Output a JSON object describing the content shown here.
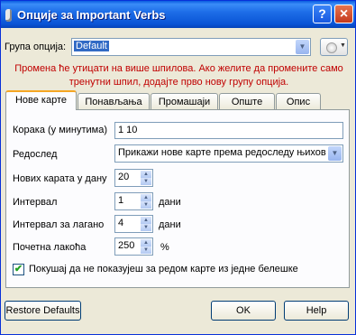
{
  "window": {
    "title": "Опције за Important Verbs",
    "help_button": "?",
    "close_button": "×"
  },
  "option_group": {
    "label": "Група опција:",
    "selected": "Default",
    "options_button_icon": "gear-icon"
  },
  "warning": {
    "line1": "Промена ће утицати на више шпилова. Ако желите да промените само",
    "line2": "тренутни шпил, додајте прво нову групу опција."
  },
  "tabs": [
    {
      "label": "Нове карте",
      "active": true
    },
    {
      "label": "Понављања",
      "active": false
    },
    {
      "label": "Промашаји",
      "active": false
    },
    {
      "label": "Опште",
      "active": false
    },
    {
      "label": "Опис",
      "active": false
    }
  ],
  "new_cards": {
    "steps_label": "Корака (у минутима)",
    "steps_value": "1 10",
    "order_label": "Редослед",
    "order_value": "Прикажи нове карте према редоследу њихов",
    "per_day_label": "Нових карата у дану",
    "per_day_value": "20",
    "interval_label": "Интервал",
    "interval_value": "1",
    "interval_unit": "дани",
    "easy_interval_label": "Интервал за лагано",
    "easy_interval_value": "4",
    "easy_interval_unit": "дани",
    "starting_ease_label": "Почетна лакоћа",
    "starting_ease_value": "250",
    "starting_ease_unit": "%",
    "bury_label": "Покушај да не показујеш за редом карте из једне белешке",
    "bury_checked": true
  },
  "footer": {
    "restore_defaults": "Restore Defaults",
    "ok": "OK",
    "help": "Help"
  }
}
